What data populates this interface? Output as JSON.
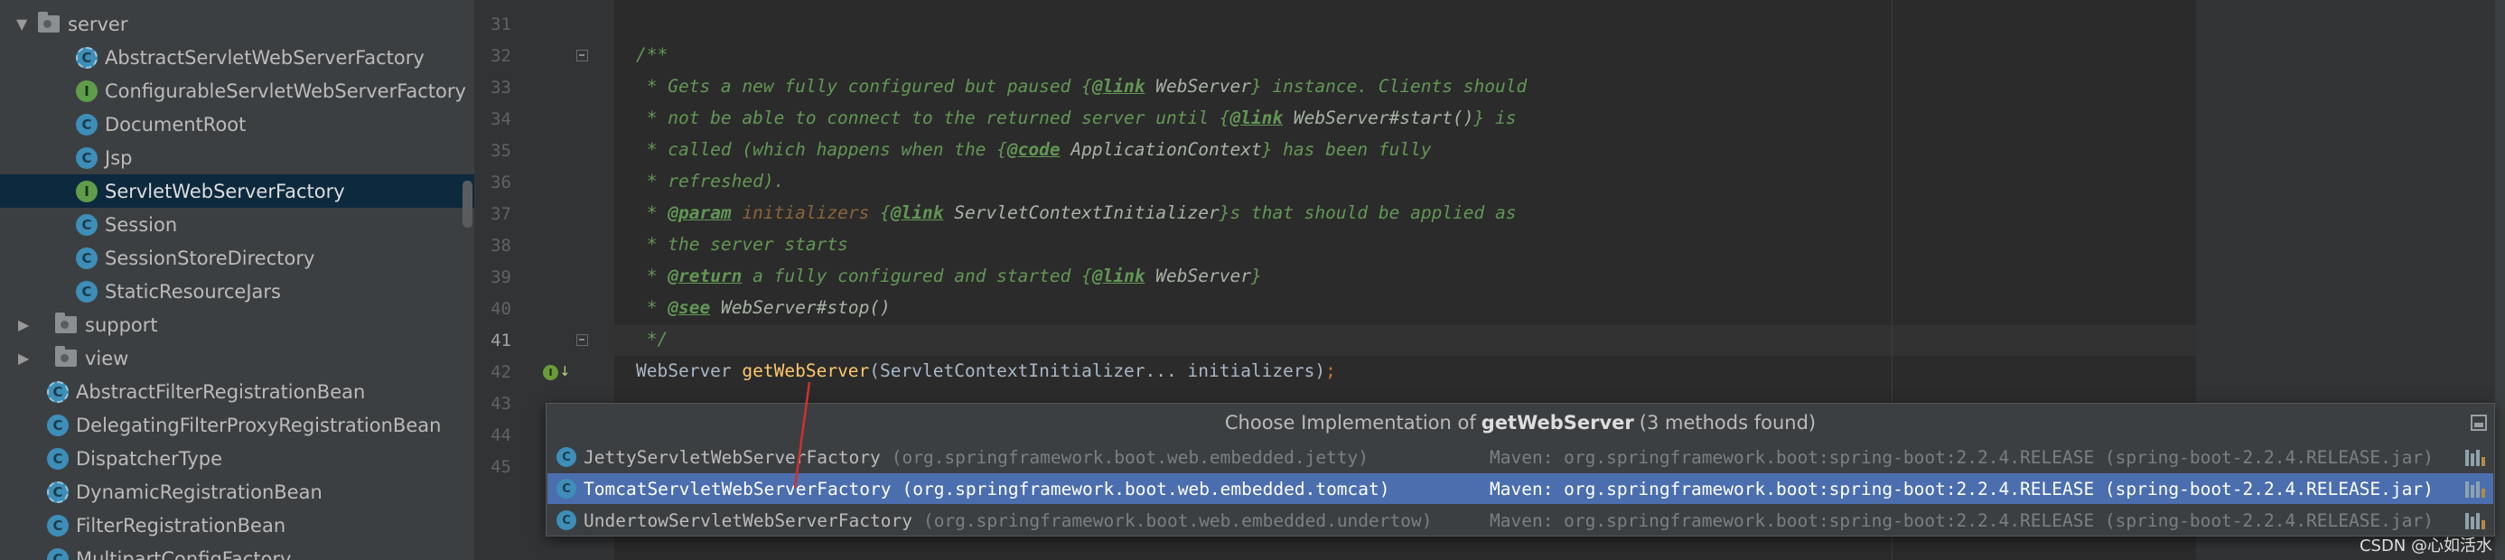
{
  "tree": {
    "items": [
      {
        "label": "server",
        "kind": "folder",
        "expanded": true,
        "indent": 0
      },
      {
        "label": "AbstractServletWebServerFactory",
        "kind": "abstract",
        "indent": 1
      },
      {
        "label": "ConfigurableServletWebServerFactory",
        "kind": "interface",
        "indent": 1
      },
      {
        "label": "DocumentRoot",
        "kind": "class",
        "indent": 1
      },
      {
        "label": "Jsp",
        "kind": "class",
        "indent": 1
      },
      {
        "label": "ServletWebServerFactory",
        "kind": "interface",
        "indent": 1,
        "selected": true
      },
      {
        "label": "Session",
        "kind": "class",
        "indent": 1
      },
      {
        "label": "SessionStoreDirectory",
        "kind": "class",
        "indent": 1
      },
      {
        "label": "StaticResourceJars",
        "kind": "class",
        "indent": 1
      },
      {
        "label": "support",
        "kind": "folder",
        "expanded": false,
        "indent": 0
      },
      {
        "label": "view",
        "kind": "folder",
        "expanded": false,
        "indent": 0
      },
      {
        "label": "AbstractFilterRegistrationBean",
        "kind": "abstract",
        "indent": 0
      },
      {
        "label": "DelegatingFilterProxyRegistrationBean",
        "kind": "class",
        "indent": 0
      },
      {
        "label": "DispatcherType",
        "kind": "class",
        "indent": 0
      },
      {
        "label": "DynamicRegistrationBean",
        "kind": "abstract",
        "indent": 0
      },
      {
        "label": "FilterRegistrationBean",
        "kind": "class",
        "indent": 0
      },
      {
        "label": "MultipartConfigFactory",
        "kind": "class",
        "indent": 0
      }
    ]
  },
  "gutter": {
    "line_numbers": [
      "31",
      "32",
      "33",
      "34",
      "35",
      "36",
      "37",
      "38",
      "39",
      "40",
      "41",
      "42",
      "43",
      "44",
      "45"
    ],
    "current_line": "41"
  },
  "code": {
    "l32": "/**",
    "l33": {
      "a": " * Gets a new fully configured but paused {",
      "tag": "@link",
      "b": " ",
      "ref": "WebServer",
      "c": "} instance. Clients should"
    },
    "l34": {
      "a": " * not be able to connect to the returned server until {",
      "tag": "@link",
      "b": " ",
      "ref": "WebServer#start()",
      "c": "} is"
    },
    "l35": {
      "a": " * called (which happens when the {",
      "tag": "@code",
      "b": " ",
      "ref": "ApplicationContext",
      "c": "} has been fully"
    },
    "l36": " * refreshed).",
    "l37": {
      "a": " * ",
      "tag": "@param",
      "b": " ",
      "pname": "initializers",
      "c": " {",
      "tag2": "@link",
      "d": " ",
      "ref": "ServletContextInitializer",
      "e": "}s that should be applied as"
    },
    "l38": " * the server starts",
    "l39": {
      "a": " * ",
      "tag": "@return",
      "b": " a fully configured and started {",
      "tag2": "@link",
      "c": " ",
      "ref": "WebServer",
      "d": "}"
    },
    "l40": {
      "a": " * ",
      "tag": "@see",
      "b": " ",
      "ref": "WebServer#stop()"
    },
    "l41": " */",
    "l42": {
      "type": "WebServer ",
      "method": "getWebServer",
      "args": "(ServletContextInitializer... initializers)",
      "semi": ";"
    }
  },
  "popup": {
    "title_prefix": "Choose Implementation of",
    "method": "getWebServer",
    "title_suffix": "(3 methods found)",
    "items": [
      {
        "name": "JettyServletWebServerFactory",
        "package": "(org.springframework.boot.web.embedded.jetty)",
        "maven": "Maven: org.springframework.boot:spring-boot:2.2.4.RELEASE (spring-boot-2.2.4.RELEASE.jar)",
        "selected": false
      },
      {
        "name": "TomcatServletWebServerFactory",
        "package": "(org.springframework.boot.web.embedded.tomcat)",
        "maven": "Maven: org.springframework.boot:spring-boot:2.2.4.RELEASE (spring-boot-2.2.4.RELEASE.jar)",
        "selected": true
      },
      {
        "name": "UndertowServletWebServerFactory",
        "package": "(org.springframework.boot.web.embedded.undertow)",
        "maven": "Maven: org.springframework.boot:spring-boot:2.2.4.RELEASE (spring-boot-2.2.4.RELEASE.jar)",
        "selected": false
      }
    ]
  },
  "watermark": "CSDN @心如活水",
  "colors": {
    "tree_bg": "#3c3f41",
    "editor_bg": "#2b2b2b",
    "selection": "#4b6eaf",
    "comment": "#629755",
    "method": "#ffc66d",
    "annotation_line": "#d03030"
  }
}
